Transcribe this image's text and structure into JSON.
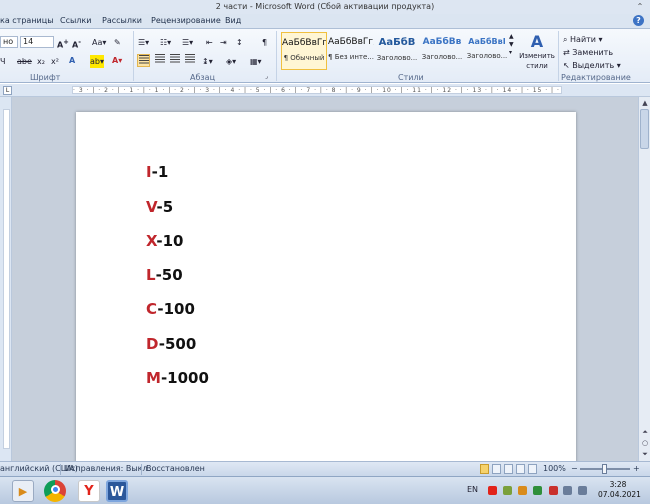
{
  "window": {
    "title": "2 части - Microsoft Word (Сбой активации продукта)"
  },
  "ribbon_tabs": [
    "ка страницы",
    "Ссылки",
    "Рассылки",
    "Рецензирование",
    "Вид"
  ],
  "font_group": {
    "font_name": "но",
    "font_size": "14",
    "label": "Шрифт"
  },
  "paragraph_group": {
    "label": "Абзац"
  },
  "styles_group": {
    "label": "Стили",
    "styles": [
      {
        "sample": "АаБбВвГг,",
        "name": "¶ Обычный",
        "selected": true
      },
      {
        "sample": "АаБбВвГг,",
        "name": "¶ Без инте...",
        "selected": false
      },
      {
        "sample": "АаБбВ",
        "name": "Заголово...",
        "selected": false
      },
      {
        "sample": "АаБбВв",
        "name": "Заголово...",
        "selected": false
      },
      {
        "sample": "АаБбВвІ",
        "name": "Заголово...",
        "selected": false
      }
    ],
    "change_styles": "Изменить стили"
  },
  "editing_group": {
    "label": "Редактирование",
    "find": "Найти",
    "replace": "Заменить",
    "select": "Выделить"
  },
  "ruler": {
    "h_scale": "· 3 · | · 2 · | · 1 · | · 1 · | · 2 · | · 3 · | · 4 · | · 5 · | · 6 · | · 7 · | · 8 · | · 9 · | · 10 · | · 11 · | · 12 · | · 13 · | · 14 · | · 15 · | · 16 · | · 17 ·",
    "tab_selector": "L"
  },
  "document": {
    "lines": [
      {
        "letter": "I",
        "rest": "-1"
      },
      {
        "letter": "V",
        "rest": "-5"
      },
      {
        "letter": "X",
        "rest": "-10"
      },
      {
        "letter": "L",
        "rest": "-50"
      },
      {
        "letter": "C",
        "rest": "-100"
      },
      {
        "letter": "D",
        "rest": "-500"
      },
      {
        "letter": "M",
        "rest": "-1000"
      }
    ]
  },
  "status_bar": {
    "language": "английский (США)",
    "track_changes": "Исправления: Выкл.",
    "recovered": "Восстановлен",
    "zoom": "100%"
  },
  "taskbar": {
    "lang": "EN",
    "time": "3:28",
    "date": "07.04.2021"
  },
  "colors": {
    "accent_red": "#c0262c",
    "ribbon_bg": "#e4ecf7"
  }
}
